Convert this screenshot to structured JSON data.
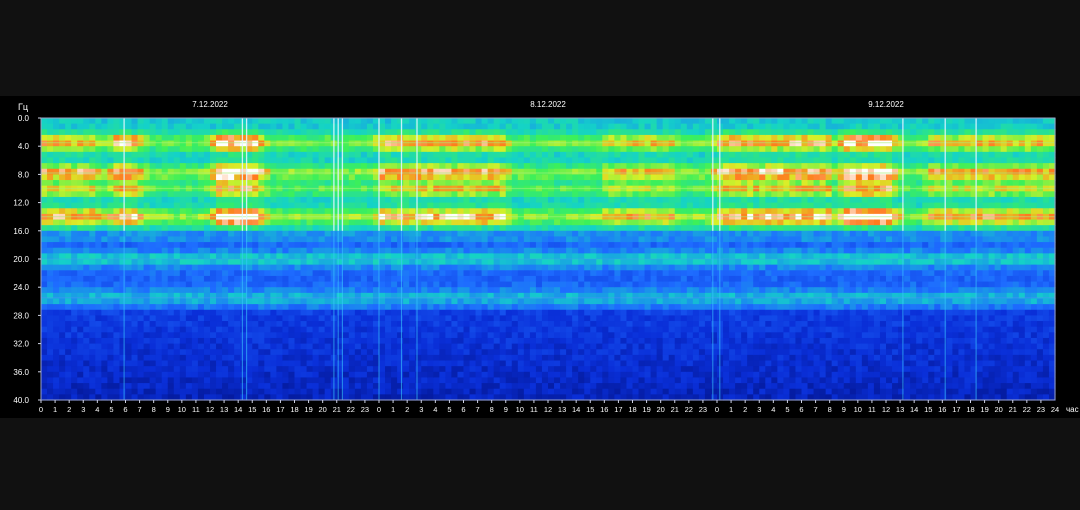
{
  "chart_data": {
    "type": "heatmap",
    "title": "",
    "ylabel": "Гц",
    "xlabel": "час",
    "ylim": [
      0,
      40
    ],
    "yticks": [
      "0.0",
      "4.0",
      "8.0",
      "12.0",
      "16.0",
      "20.0",
      "24.0",
      "28.0",
      "32.0",
      "36.0",
      "40.0"
    ],
    "y_reversed": true,
    "x_unit_label": "час",
    "days": [
      {
        "date": "7.12.2022",
        "hours": [
          0,
          1,
          2,
          3,
          4,
          5,
          6,
          7,
          8,
          9,
          10,
          11,
          12,
          13,
          14,
          15,
          16,
          17,
          18,
          19,
          20,
          21,
          22,
          23
        ]
      },
      {
        "date": "8.12.2022",
        "hours": [
          0,
          1,
          2,
          3,
          4,
          5,
          6,
          7,
          8,
          9,
          10,
          11,
          12,
          13,
          14,
          15,
          16,
          17,
          18,
          19,
          20,
          21,
          22,
          23
        ]
      },
      {
        "date": "9.12.2022",
        "hours": [
          0,
          1,
          2,
          3,
          4,
          5,
          6,
          7,
          8,
          9,
          10,
          11,
          12,
          13,
          14,
          15,
          16,
          17,
          18,
          19,
          20,
          21,
          22,
          23
        ]
      }
    ],
    "final_hour_label": "24",
    "colorscale": [
      "#000a6e",
      "#0a2fd8",
      "#1e6cff",
      "#14d2c8",
      "#3cf05a",
      "#d8f028",
      "#ff7a1e",
      "#ffffff"
    ],
    "resonance_bands_hz": [
      {
        "center": 3.5,
        "intensity": 0.62
      },
      {
        "center": 7.8,
        "intensity": 0.68
      },
      {
        "center": 10.0,
        "intensity": 0.5
      },
      {
        "center": 14.0,
        "intensity": 0.72
      },
      {
        "center": 20.0,
        "intensity": 0.28
      },
      {
        "center": 25.5,
        "intensity": 0.22
      }
    ],
    "active_periods_hours": [
      {
        "from": 0,
        "to": 4,
        "intensity": 0.7
      },
      {
        "from": 5,
        "to": 7,
        "intensity": 0.85
      },
      {
        "from": 12.5,
        "to": 15.5,
        "intensity": 1.0
      },
      {
        "from": 24,
        "to": 33,
        "intensity": 0.75
      },
      {
        "from": 40,
        "to": 45,
        "intensity": 0.6
      },
      {
        "from": 48,
        "to": 56,
        "intensity": 0.8
      },
      {
        "from": 57,
        "to": 60.5,
        "intensity": 1.0
      },
      {
        "from": 63,
        "to": 72,
        "intensity": 0.65
      }
    ],
    "vertical_bursts_hours": [
      5.9,
      14.3,
      14.6,
      20.8,
      21.1,
      21.4,
      24.0,
      25.6,
      26.7,
      47.7,
      48.2,
      61.2,
      64.2,
      66.4
    ]
  }
}
